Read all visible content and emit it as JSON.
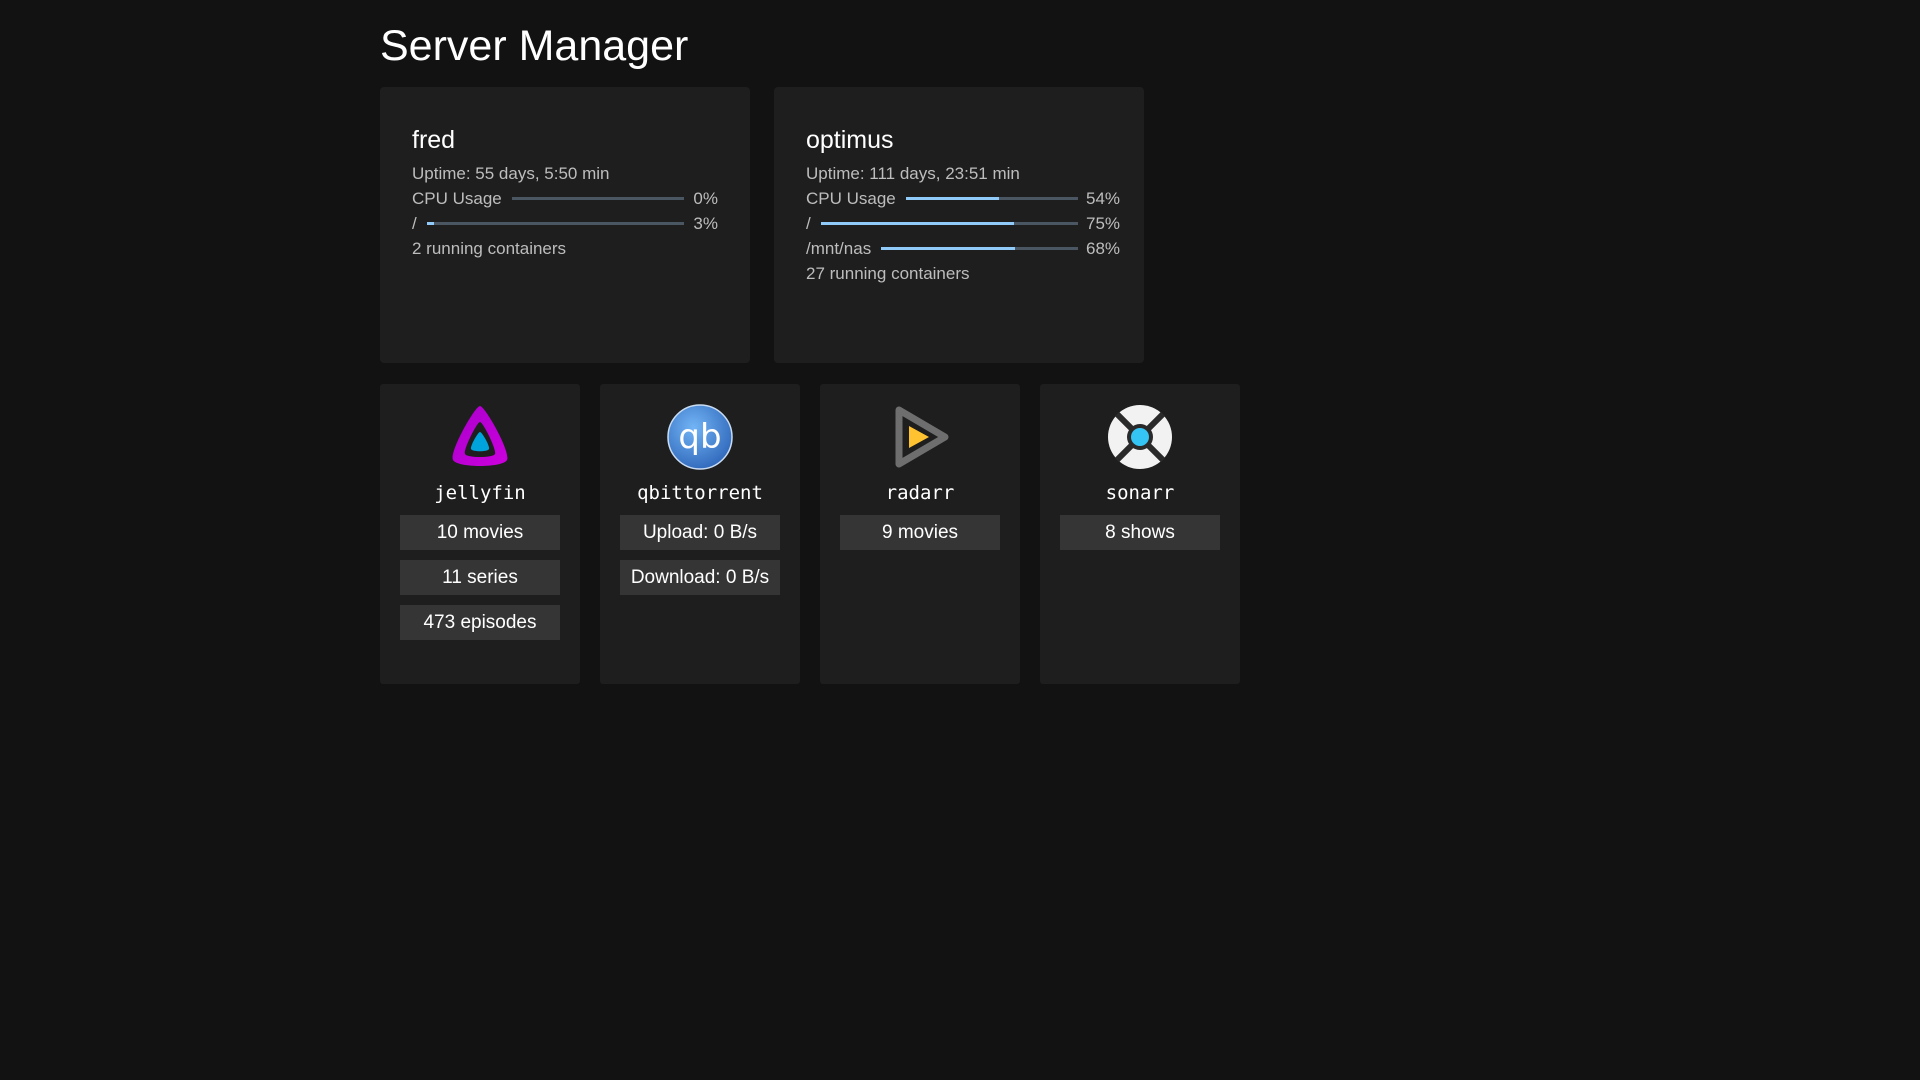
{
  "page": {
    "title": "Server Manager"
  },
  "servers": [
    {
      "name": "fred",
      "uptime": "Uptime: 55 days, 5:50 min",
      "metrics": [
        {
          "label": "CPU Usage",
          "value": "0%",
          "percent": 0
        },
        {
          "label": "/",
          "value": "3%",
          "percent": 3
        }
      ],
      "containers": "2 running containers"
    },
    {
      "name": "optimus",
      "uptime": "Uptime: 111 days, 23:51 min",
      "metrics": [
        {
          "label": "CPU Usage",
          "value": "54%",
          "percent": 54
        },
        {
          "label": "/",
          "value": "75%",
          "percent": 75
        },
        {
          "label": "/mnt/nas",
          "value": "68%",
          "percent": 68
        }
      ],
      "containers": "27 running containers"
    }
  ],
  "apps": [
    {
      "name": "jellyfin",
      "icon": "jellyfin-icon",
      "stats": [
        "10 movies",
        "11 series",
        "473 episodes"
      ]
    },
    {
      "name": "qbittorrent",
      "icon": "qbittorrent-icon",
      "stats": [
        "Upload: 0 B/s",
        "Download: 0 B/s"
      ]
    },
    {
      "name": "radarr",
      "icon": "radarr-icon",
      "stats": [
        "9 movies"
      ]
    },
    {
      "name": "sonarr",
      "icon": "sonarr-icon",
      "stats": [
        "8 shows"
      ]
    }
  ],
  "colors": {
    "background": "#121212",
    "card": "#1e1e1e",
    "bar_track": "#4a5661",
    "bar_fill": "#90caf9",
    "stat_bg": "#353535"
  }
}
